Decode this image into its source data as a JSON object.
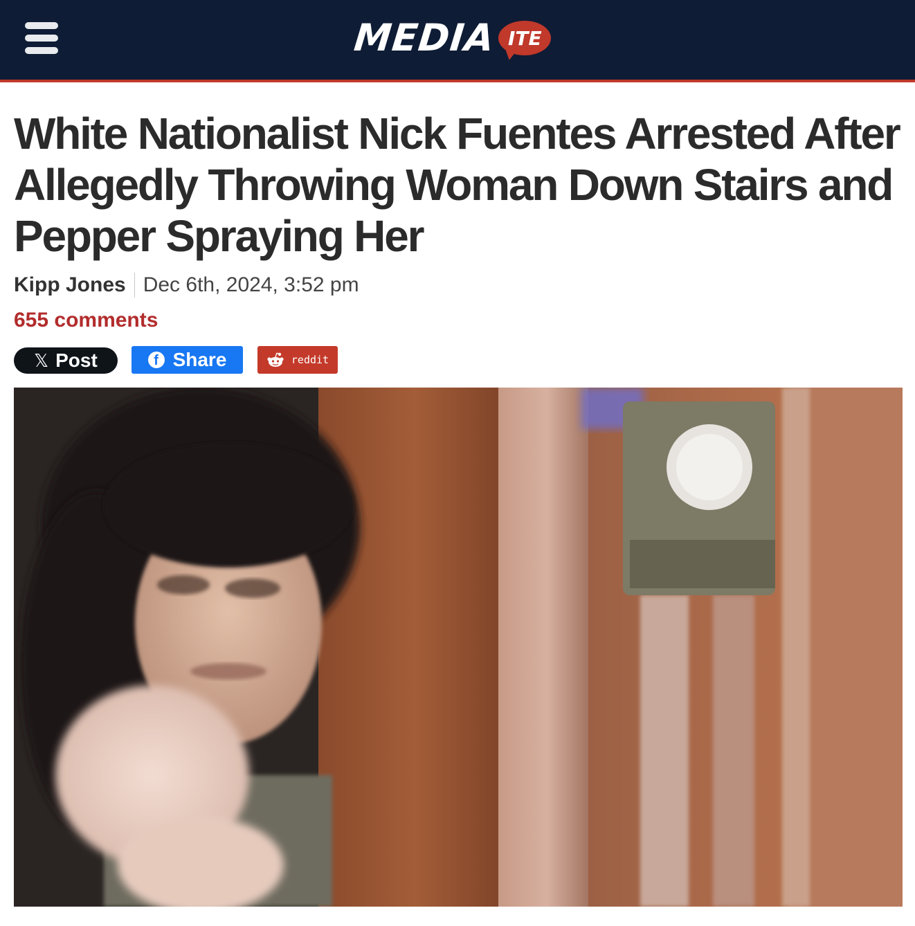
{
  "header": {
    "logo_main": "MEDIA",
    "logo_badge": "ITE"
  },
  "article": {
    "headline": "White Nationalist Nick Fuentes Arrested After Allegedly Throwing Woman Down Stairs and Pepper Spraying Her",
    "author": "Kipp Jones",
    "date": "Dec 6th, 2024, 3:52 pm",
    "comments": "655 comments"
  },
  "share": {
    "x_label": "Post",
    "x_icon": "x-logo-icon",
    "facebook_label": "Share",
    "facebook_icon": "facebook-icon",
    "reddit_label": "reddit",
    "reddit_icon": "reddit-alien-icon"
  },
  "colors": {
    "header_bg": "#0f1c35",
    "accent_red": "#c0392b",
    "facebook_blue": "#1877f2",
    "x_black": "#0f1419",
    "comments_red": "#b22c2c"
  }
}
